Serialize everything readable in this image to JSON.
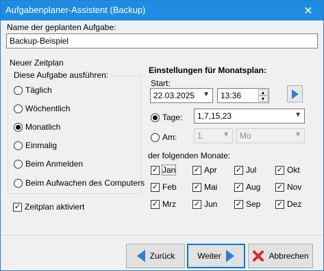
{
  "window": {
    "title": "Aufgabenplaner-Assistent (Backup)",
    "close_symbol": "✕"
  },
  "task_name": {
    "label": "Name der geplanten Aufgabe:",
    "value": "Backup-Beispiel"
  },
  "schedule": {
    "label": "Neuer Zeitplan",
    "group_label": "Diese Aufgabe ausführen:",
    "options": [
      "Täglich",
      "Wöchentlich",
      "Monatlich",
      "Einmalig",
      "Beim Anmelden",
      "Beim Aufwachen des Computers"
    ],
    "selected": "Monatlich",
    "enabled_label": "Zeitplan aktiviert",
    "enabled": true
  },
  "monthly": {
    "heading": "Einstellungen für Monatsplan:",
    "start_label": "Start:",
    "start_date": "22.03.2025",
    "start_time": "13:36",
    "days_label": "Tage:",
    "days_value": "1,7,15,23",
    "on_label": "Am:",
    "on_week": "1.",
    "on_weekday": "Mo",
    "months_label": "der folgenden Monate:",
    "months": [
      "Jan",
      "Apr",
      "Jul",
      "Okt",
      "Feb",
      "Mai",
      "Aug",
      "Nov",
      "Mrz",
      "Jun",
      "Sep",
      "Dez"
    ]
  },
  "buttons": {
    "back": "Zurück",
    "next": "Weiter",
    "cancel": "Abbrechen"
  }
}
